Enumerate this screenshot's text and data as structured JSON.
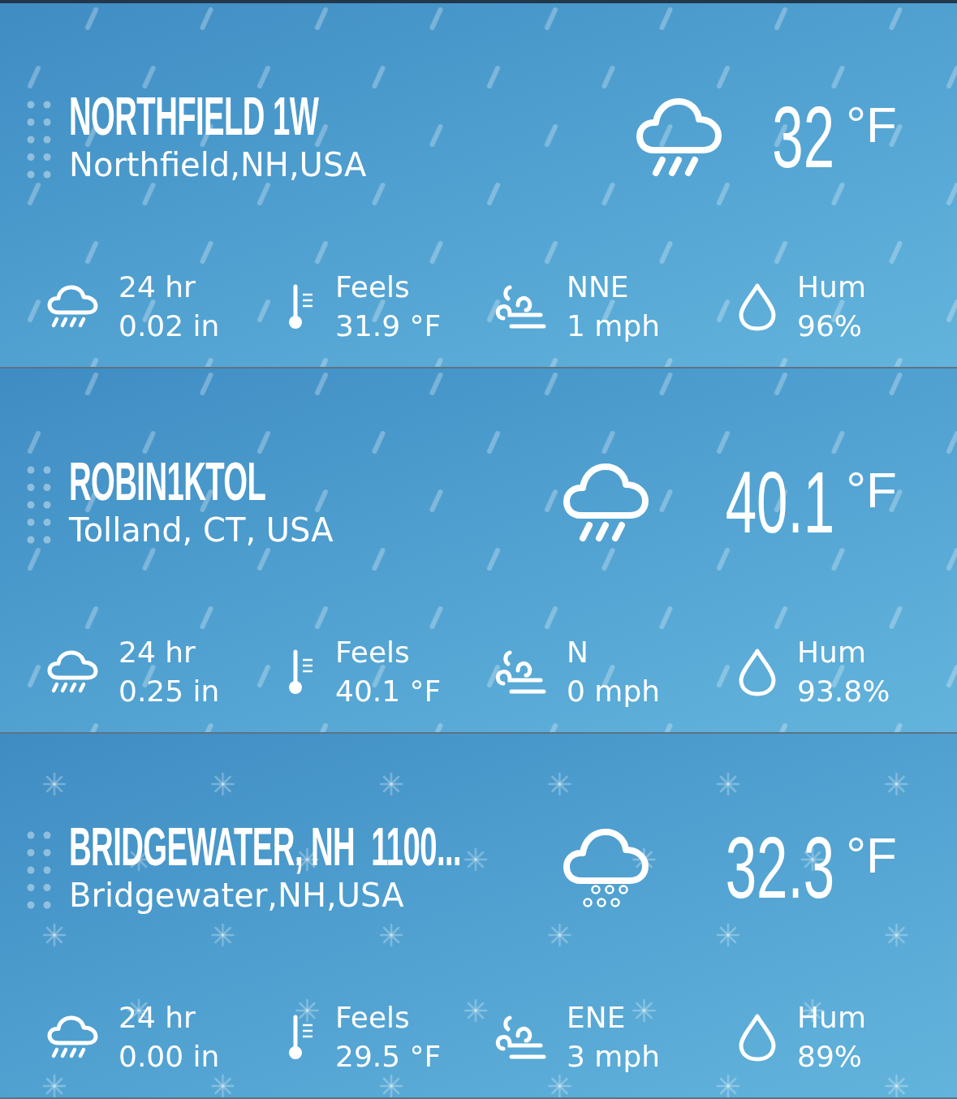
{
  "stations": [
    {
      "title": "NORTHFIELD 1W",
      "location": "Northfield,NH,USA",
      "kind": "rain",
      "temperature": "32",
      "unit": "°F",
      "stats": {
        "precip_label": "24 hr",
        "precip_value": "0.02 in",
        "feels_label": "Feels",
        "feels_value": "31.9 °F",
        "wind_direction": "NNE",
        "wind_speed": "1 mph",
        "humidity_label": "Hum",
        "humidity_value": "96%"
      }
    },
    {
      "title": "ROBIN1KTOL",
      "location": "Tolland, CT, USA",
      "kind": "rain",
      "temperature": "40.1",
      "unit": "°F",
      "stats": {
        "precip_label": "24 hr",
        "precip_value": "0.25 in",
        "feels_label": "Feels",
        "feels_value": "40.1 °F",
        "wind_direction": "N",
        "wind_speed": "0 mph",
        "humidity_label": "Hum",
        "humidity_value": "93.8%"
      }
    },
    {
      "title": "BRIDGEWATER, NH  1100...",
      "location": "Bridgewater,NH,USA",
      "kind": "snow",
      "temperature": "32.3",
      "unit": "°F",
      "stats": {
        "precip_label": "24 hr",
        "precip_value": "0.00 in",
        "feels_label": "Feels",
        "feels_value": "29.5 °F",
        "wind_direction": "ENE",
        "wind_speed": "3 mph",
        "humidity_label": "Hum",
        "humidity_value": "89%"
      }
    }
  ]
}
